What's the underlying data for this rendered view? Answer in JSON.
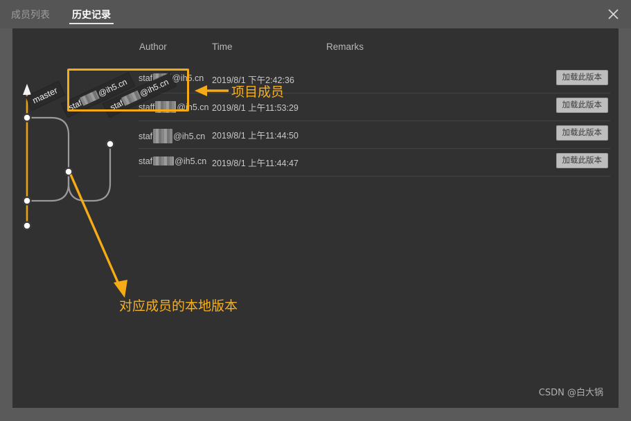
{
  "window": {
    "close_icon": "close-icon",
    "bg_color": "#313131",
    "titlebar_color": "#555555",
    "accent_color": "#f5ab15"
  },
  "tabs": [
    {
      "label": "成员列表",
      "active": false
    },
    {
      "label": "历史记录",
      "active": true
    }
  ],
  "columns": {
    "author": "Author",
    "time": "Time",
    "remarks": "Remarks"
  },
  "rows": [
    {
      "author_prefix": "staf",
      "author_suffix": "@ih5.cn",
      "time": "2019/8/1 下午2:42:36",
      "remarks": "",
      "button": "加载此版本"
    },
    {
      "author_prefix": "staff",
      "author_suffix": "@ih5.cn",
      "time": "2019/8/1 上午11:53:29",
      "remarks": "",
      "button": "加载此版本"
    },
    {
      "author_prefix": "staf",
      "author_suffix": "@ih5.cn",
      "time": "2019/8/1 上午11:44:50",
      "remarks": "",
      "button": "加载此版本"
    },
    {
      "author_prefix": "staf",
      "author_suffix": "@ih5.cn",
      "time": "2019/8/1 上午11:44:47",
      "remarks": "",
      "button": "加载此版本"
    }
  ],
  "graph": {
    "branch_tags": [
      {
        "label": "master"
      },
      {
        "label_prefix": "staf",
        "label_suffix": "@ih5.cn"
      },
      {
        "label_prefix": "staf",
        "label_suffix": "@ih5.cn"
      }
    ],
    "main_branch_color": "#e8a317",
    "side_branch_color": "#9a9a9a",
    "node_fill": "#ffffff",
    "node_stroke": "#3a3a3a"
  },
  "annotations": {
    "members": "项目成员",
    "local_version": "对应成员的本地版本",
    "color": "#f7b022"
  },
  "watermark": "CSDN @白大锅"
}
